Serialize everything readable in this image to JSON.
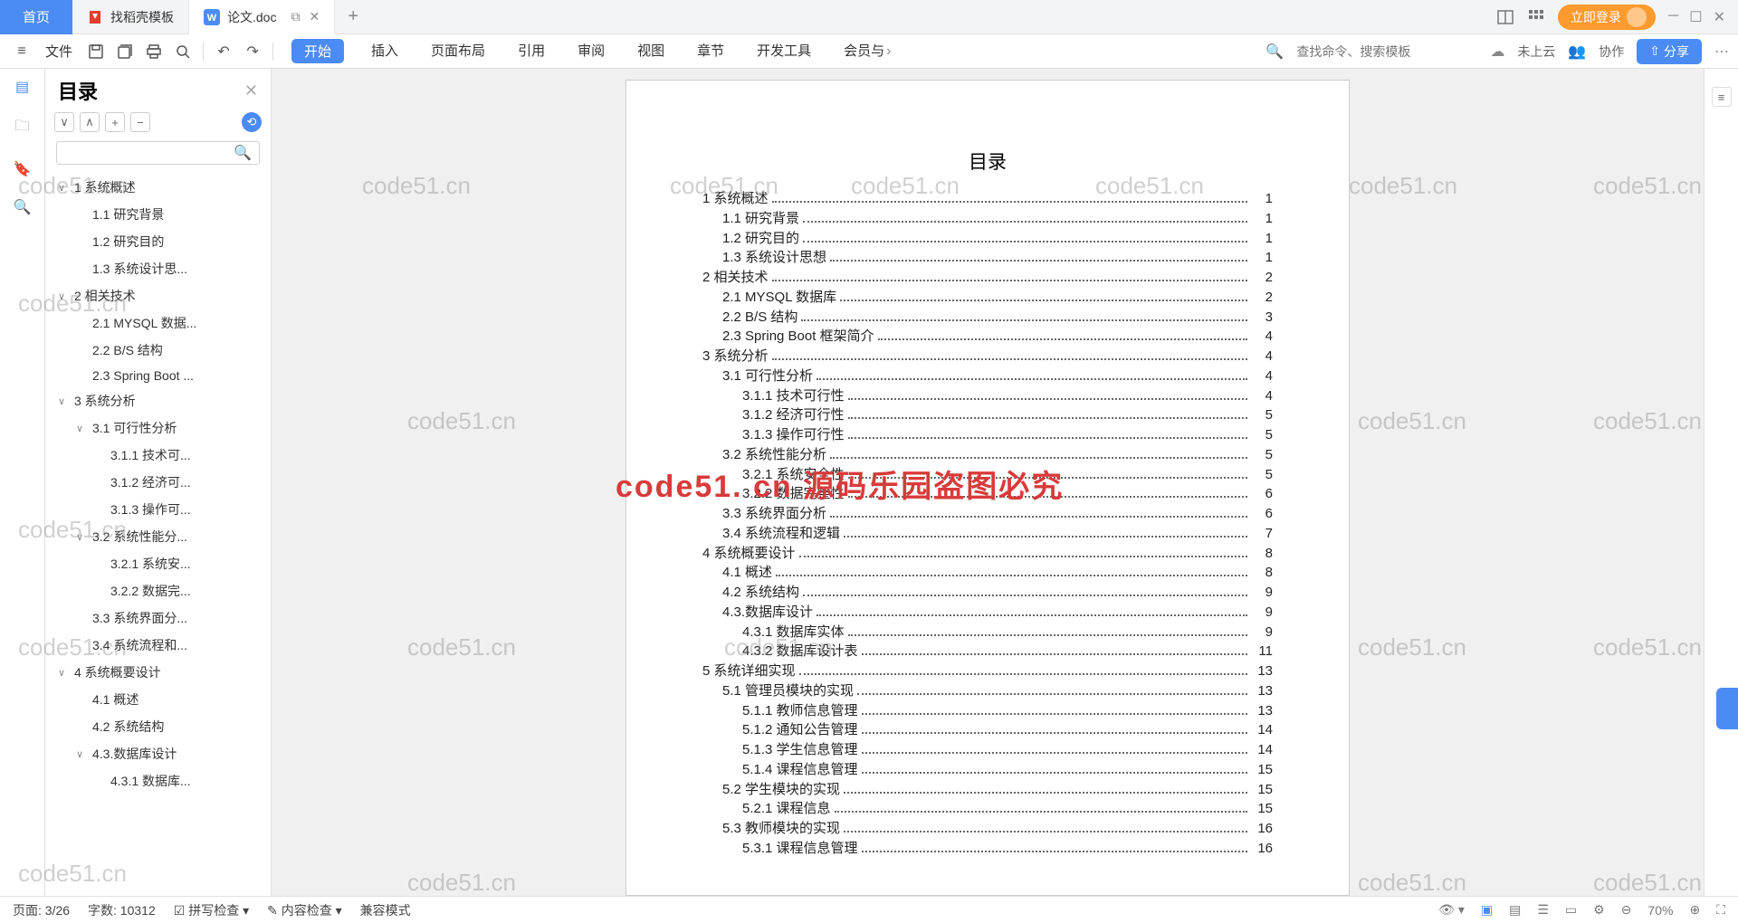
{
  "titlebar": {
    "home": "首页",
    "tab1": "找稻壳模板",
    "tab2": "论文.doc",
    "login": "立即登录"
  },
  "toolbar": {
    "file": "文件",
    "start": "开始",
    "insert": "插入",
    "layout": "页面布局",
    "ref": "引用",
    "review": "审阅",
    "view": "视图",
    "chapter": "章节",
    "dev": "开发工具",
    "member": "会员与",
    "search_placeholder": "查找命令、搜索模板",
    "cloud": "未上云",
    "collab": "协作",
    "share": "分享"
  },
  "outline": {
    "title": "目录",
    "items": [
      {
        "lvl": 1,
        "chev": "∨",
        "t": "1 系统概述"
      },
      {
        "lvl": 2,
        "t": "1.1 研究背景"
      },
      {
        "lvl": 2,
        "t": "1.2 研究目的"
      },
      {
        "lvl": 2,
        "t": "1.3 系统设计思..."
      },
      {
        "lvl": 1,
        "chev": "∨",
        "t": "2 相关技术"
      },
      {
        "lvl": 2,
        "t": "2.1 MYSQL 数据..."
      },
      {
        "lvl": 2,
        "t": "2.2 B/S 结构"
      },
      {
        "lvl": 2,
        "t": "2.3 Spring Boot ..."
      },
      {
        "lvl": 1,
        "chev": "∨",
        "t": "3 系统分析"
      },
      {
        "lvl": 2,
        "chev": "∨",
        "t": "3.1 可行性分析"
      },
      {
        "lvl": 3,
        "t": "3.1.1 技术可..."
      },
      {
        "lvl": 3,
        "t": "3.1.2 经济可..."
      },
      {
        "lvl": 3,
        "t": "3.1.3 操作可..."
      },
      {
        "lvl": 2,
        "chev": "∨",
        "t": "3.2 系统性能分..."
      },
      {
        "lvl": 3,
        "t": "3.2.1 系统安..."
      },
      {
        "lvl": 3,
        "t": "3.2.2 数据完..."
      },
      {
        "lvl": 2,
        "t": "3.3 系统界面分..."
      },
      {
        "lvl": 2,
        "t": "3.4 系统流程和..."
      },
      {
        "lvl": 1,
        "chev": "∨",
        "t": "4 系统概要设计"
      },
      {
        "lvl": 2,
        "t": "4.1 概述"
      },
      {
        "lvl": 2,
        "t": "4.2 系统结构"
      },
      {
        "lvl": 2,
        "chev": "∨",
        "t": "4.3.数据库设计"
      },
      {
        "lvl": 3,
        "t": "4.3.1 数据库..."
      }
    ]
  },
  "doc": {
    "title": "目录",
    "toc": [
      {
        "ind": 0,
        "t": "1 系统概述",
        "p": "1"
      },
      {
        "ind": 1,
        "t": "1.1 研究背景",
        "p": "1"
      },
      {
        "ind": 1,
        "t": "1.2 研究目的",
        "p": "1"
      },
      {
        "ind": 1,
        "t": "1.3 系统设计思想",
        "p": "1"
      },
      {
        "ind": 0,
        "t": "2 相关技术",
        "p": "2"
      },
      {
        "ind": 1,
        "t": "2.1 MYSQL 数据库",
        "p": "2"
      },
      {
        "ind": 1,
        "t": "2.2 B/S 结构",
        "p": "3"
      },
      {
        "ind": 1,
        "t": "2.3 Spring Boot 框架简介",
        "p": "4"
      },
      {
        "ind": 0,
        "t": "3 系统分析",
        "p": "4"
      },
      {
        "ind": 1,
        "t": "3.1 可行性分析",
        "p": "4"
      },
      {
        "ind": 2,
        "t": "3.1.1 技术可行性",
        "p": "4"
      },
      {
        "ind": 2,
        "t": "3.1.2 经济可行性",
        "p": "5"
      },
      {
        "ind": 2,
        "t": "3.1.3 操作可行性",
        "p": "5"
      },
      {
        "ind": 1,
        "t": "3.2 系统性能分析",
        "p": "5"
      },
      {
        "ind": 2,
        "t": "3.2.1 系统安全性",
        "p": "5"
      },
      {
        "ind": 2,
        "t": "3.2.2 数据完整性",
        "p": "6"
      },
      {
        "ind": 1,
        "t": "3.3 系统界面分析",
        "p": "6"
      },
      {
        "ind": 1,
        "t": "3.4 系统流程和逻辑",
        "p": "7"
      },
      {
        "ind": 0,
        "t": "4 系统概要设计",
        "p": "8"
      },
      {
        "ind": 1,
        "t": "4.1 概述",
        "p": "8"
      },
      {
        "ind": 1,
        "t": "4.2 系统结构",
        "p": "9"
      },
      {
        "ind": 1,
        "t": "4.3.数据库设计",
        "p": "9"
      },
      {
        "ind": 2,
        "t": "4.3.1 数据库实体",
        "p": "9"
      },
      {
        "ind": 2,
        "t": "4.3.2 数据库设计表",
        "p": "11"
      },
      {
        "ind": 0,
        "t": "5 系统详细实现",
        "p": "13"
      },
      {
        "ind": 1,
        "t": "5.1 管理员模块的实现",
        "p": "13"
      },
      {
        "ind": 2,
        "t": "5.1.1 教师信息管理",
        "p": "13"
      },
      {
        "ind": 2,
        "t": "5.1.2 通知公告管理",
        "p": "14"
      },
      {
        "ind": 2,
        "t": "5.1.3 学生信息管理",
        "p": "14"
      },
      {
        "ind": 2,
        "t": "5.1.4 课程信息管理",
        "p": "15"
      },
      {
        "ind": 1,
        "t": "5.2 学生模块的实现",
        "p": "15"
      },
      {
        "ind": 2,
        "t": "5.2.1 课程信息",
        "p": "15"
      },
      {
        "ind": 1,
        "t": "5.3 教师模块的实现",
        "p": "16"
      },
      {
        "ind": 2,
        "t": "5.3.1 课程信息管理",
        "p": "16"
      }
    ]
  },
  "status": {
    "page": "页面: 3/26",
    "words": "字数: 10312",
    "spell": "拼写检查",
    "content": "内容检查",
    "compat": "兼容模式",
    "zoom": "70%"
  },
  "watermark": {
    "small": "code51.cn",
    "big": "code51. cn  源码乐园盗图必究"
  }
}
